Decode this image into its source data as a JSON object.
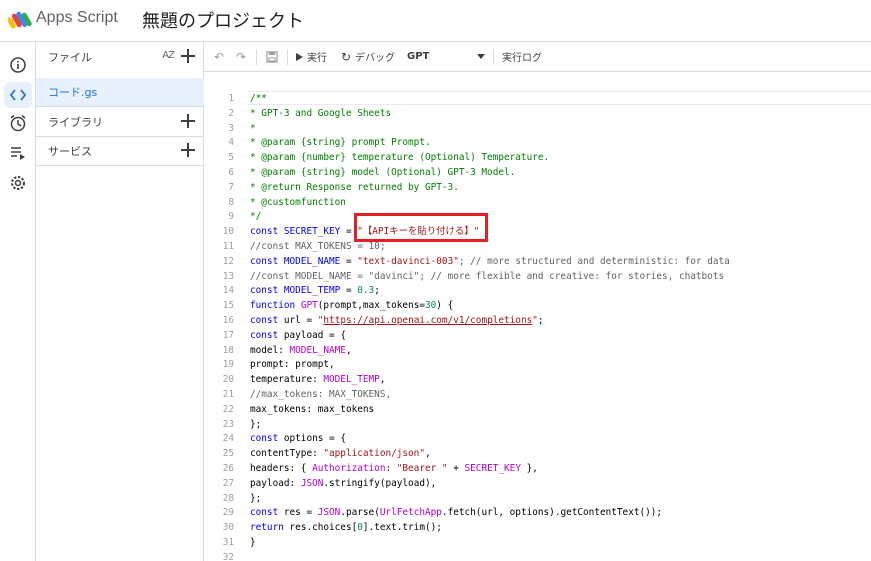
{
  "header": {
    "app_name": "Apps Script",
    "project_title": "無題のプロジェクト"
  },
  "rail": {
    "items": [
      {
        "icon": "info-icon",
        "active": false
      },
      {
        "icon": "code-icon",
        "active": true
      },
      {
        "icon": "clock-icon",
        "active": false
      },
      {
        "icon": "executions-icon",
        "active": false
      },
      {
        "icon": "gear-icon",
        "active": false
      }
    ]
  },
  "files_panel": {
    "files_label": "ファイル",
    "sort_label": "AZ",
    "file_name": "コード.gs",
    "libraries_label": "ライブラリ",
    "services_label": "サービス"
  },
  "toolbar": {
    "run_label": "実行",
    "debug_label": "デバッグ",
    "function_select": "GPT",
    "log_label": "実行ログ"
  },
  "editor": {
    "highlight_color": "#e31e24",
    "lines": [
      {
        "n": "1",
        "segs": [
          [
            "/**",
            "c-com"
          ]
        ]
      },
      {
        "n": "2",
        "segs": [
          [
            "* GPT-3 and Google Sheets",
            "c-com"
          ]
        ]
      },
      {
        "n": "3",
        "segs": [
          [
            "*",
            "c-com"
          ]
        ]
      },
      {
        "n": "4",
        "segs": [
          [
            "* @param {string} prompt Prompt.",
            "c-com"
          ]
        ]
      },
      {
        "n": "5",
        "segs": [
          [
            "* @param {number} temperature (Optional) Temperature.",
            "c-com"
          ]
        ]
      },
      {
        "n": "6",
        "segs": [
          [
            "* @param {string} model (Optional) GPT-3 Model.",
            "c-com"
          ]
        ]
      },
      {
        "n": "7",
        "segs": [
          [
            "* @return Response returned by GPT-3.",
            "c-com"
          ]
        ]
      },
      {
        "n": "8",
        "segs": [
          [
            "* @customfunction",
            "c-com"
          ]
        ]
      },
      {
        "n": "9",
        "segs": [
          [
            "*/",
            "c-com"
          ]
        ]
      },
      {
        "n": "10",
        "segs": [
          [
            "const ",
            "c-kw"
          ],
          [
            "SECRET_KEY",
            "c-var"
          ],
          [
            " = ",
            "c-def"
          ],
          [
            "\"【APIキーを貼り付ける】\"",
            "c-str"
          ]
        ]
      },
      {
        "n": "11",
        "segs": [
          [
            "//const MAX_TOKENS = 10;",
            "c-grey"
          ]
        ]
      },
      {
        "n": "12",
        "segs": [
          [
            "const ",
            "c-kw"
          ],
          [
            "MODEL_NAME",
            "c-var"
          ],
          [
            " = ",
            "c-def"
          ],
          [
            "\"text-davinci-003\"",
            "c-str"
          ],
          [
            "; // more structured and deterministic: for data",
            "c-grey"
          ]
        ]
      },
      {
        "n": "13",
        "segs": [
          [
            "//const MODEL_NAME = \"davinci\"; // more flexible and creative: for stories, chatbots",
            "c-grey"
          ]
        ]
      },
      {
        "n": "14",
        "segs": [
          [
            "const ",
            "c-kw"
          ],
          [
            "MODEL_TEMP",
            "c-var"
          ],
          [
            " = ",
            "c-def"
          ],
          [
            "0.3",
            "c-num"
          ],
          [
            ";",
            "c-def"
          ]
        ]
      },
      {
        "n": "15",
        "segs": [
          [
            "function ",
            "c-kw"
          ],
          [
            "GPT",
            "c-mag"
          ],
          [
            "(prompt,max_tokens=",
            "c-def"
          ],
          [
            "30",
            "c-num"
          ],
          [
            ") {",
            "c-def"
          ]
        ]
      },
      {
        "n": "16",
        "segs": [
          [
            "const ",
            "c-kw"
          ],
          [
            "url",
            "c-def"
          ],
          [
            " = ",
            "c-def"
          ],
          [
            "\"",
            "c-str"
          ],
          [
            "https://api.openai.com/v1/completions",
            "c-url"
          ],
          [
            "\"",
            "c-str"
          ],
          [
            ";",
            "c-def"
          ]
        ]
      },
      {
        "n": "17",
        "segs": [
          [
            "const ",
            "c-kw"
          ],
          [
            "payload = {",
            "c-def"
          ]
        ]
      },
      {
        "n": "18",
        "segs": [
          [
            "model: ",
            "c-def"
          ],
          [
            "MODEL_NAME",
            "c-mag"
          ],
          [
            ",",
            "c-def"
          ]
        ]
      },
      {
        "n": "19",
        "segs": [
          [
            "prompt: prompt,",
            "c-def"
          ]
        ]
      },
      {
        "n": "20",
        "segs": [
          [
            "temperature: ",
            "c-def"
          ],
          [
            "MODEL_TEMP",
            "c-mag"
          ],
          [
            ",",
            "c-def"
          ]
        ]
      },
      {
        "n": "21",
        "segs": [
          [
            "//max_tokens: MAX_TOKENS,",
            "c-grey"
          ]
        ]
      },
      {
        "n": "22",
        "segs": [
          [
            "max_tokens: max_tokens",
            "c-def"
          ]
        ]
      },
      {
        "n": "23",
        "segs": [
          [
            "};",
            "c-def"
          ]
        ]
      },
      {
        "n": "24",
        "segs": [
          [
            "const ",
            "c-kw"
          ],
          [
            "options = {",
            "c-def"
          ]
        ]
      },
      {
        "n": "25",
        "segs": [
          [
            "contentType: ",
            "c-def"
          ],
          [
            "\"application/json\"",
            "c-str"
          ],
          [
            ",",
            "c-def"
          ]
        ]
      },
      {
        "n": "26",
        "segs": [
          [
            "headers: { ",
            "c-def"
          ],
          [
            "Authorization",
            "c-mag"
          ],
          [
            ": ",
            "c-def"
          ],
          [
            "\"Bearer \"",
            "c-str"
          ],
          [
            " + ",
            "c-def"
          ],
          [
            "SECRET_KEY",
            "c-mag"
          ],
          [
            " },",
            "c-def"
          ]
        ]
      },
      {
        "n": "27",
        "segs": [
          [
            "payload: ",
            "c-def"
          ],
          [
            "JSON",
            "c-mag"
          ],
          [
            ".stringify(payload),",
            "c-def"
          ]
        ]
      },
      {
        "n": "28",
        "segs": [
          [
            "};",
            "c-def"
          ]
        ]
      },
      {
        "n": "29",
        "segs": [
          [
            "const ",
            "c-kw"
          ],
          [
            "res = ",
            "c-def"
          ],
          [
            "JSON",
            "c-mag"
          ],
          [
            ".parse(",
            "c-def"
          ],
          [
            "UrlFetchApp",
            "c-mag"
          ],
          [
            ".fetch(url, options).getContentText());",
            "c-def"
          ]
        ]
      },
      {
        "n": "30",
        "segs": [
          [
            "return ",
            "c-kw"
          ],
          [
            "res.choices[",
            "c-def"
          ],
          [
            "0",
            "c-num"
          ],
          [
            "].text.trim();",
            "c-def"
          ]
        ]
      },
      {
        "n": "31",
        "segs": [
          [
            "}",
            "c-def"
          ]
        ]
      },
      {
        "n": "32",
        "segs": []
      }
    ]
  }
}
